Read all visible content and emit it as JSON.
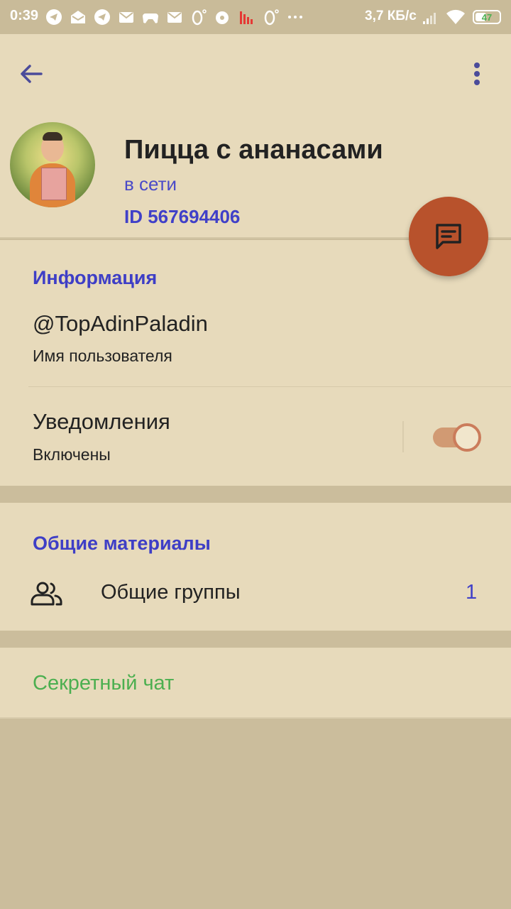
{
  "status_bar": {
    "time": "0:39",
    "network_speed": "3,7 КБ/с",
    "battery": "47",
    "battery_level": 0.47,
    "notification_icons": [
      "telegram-icon",
      "mail-open-icon",
      "telegram-icon",
      "mail-muted-icon",
      "gamepad-icon",
      "mail-muted-icon",
      "zero-degree-icon",
      "disc-icon",
      "signal-bars-icon",
      "zero-degree-icon",
      "more-dots-icon"
    ]
  },
  "profile": {
    "name": "Пицца с ананасами",
    "status": "в сети",
    "id": "ID 567694406"
  },
  "info": {
    "heading": "Информация",
    "username": "@TopAdinPaladin",
    "username_caption": "Имя пользователя",
    "notifications_title": "Уведомления",
    "notifications_caption": "Включены",
    "notifications_enabled": true
  },
  "shared": {
    "heading": "Общие материалы",
    "groups_label": "Общие группы",
    "groups_count": "1"
  },
  "secret_chat": "Секретный чат",
  "colors": {
    "background": "#e7dabb",
    "accent_blue": "#4040c8",
    "fab": "#b8522c",
    "secret_green": "#4caf50"
  }
}
